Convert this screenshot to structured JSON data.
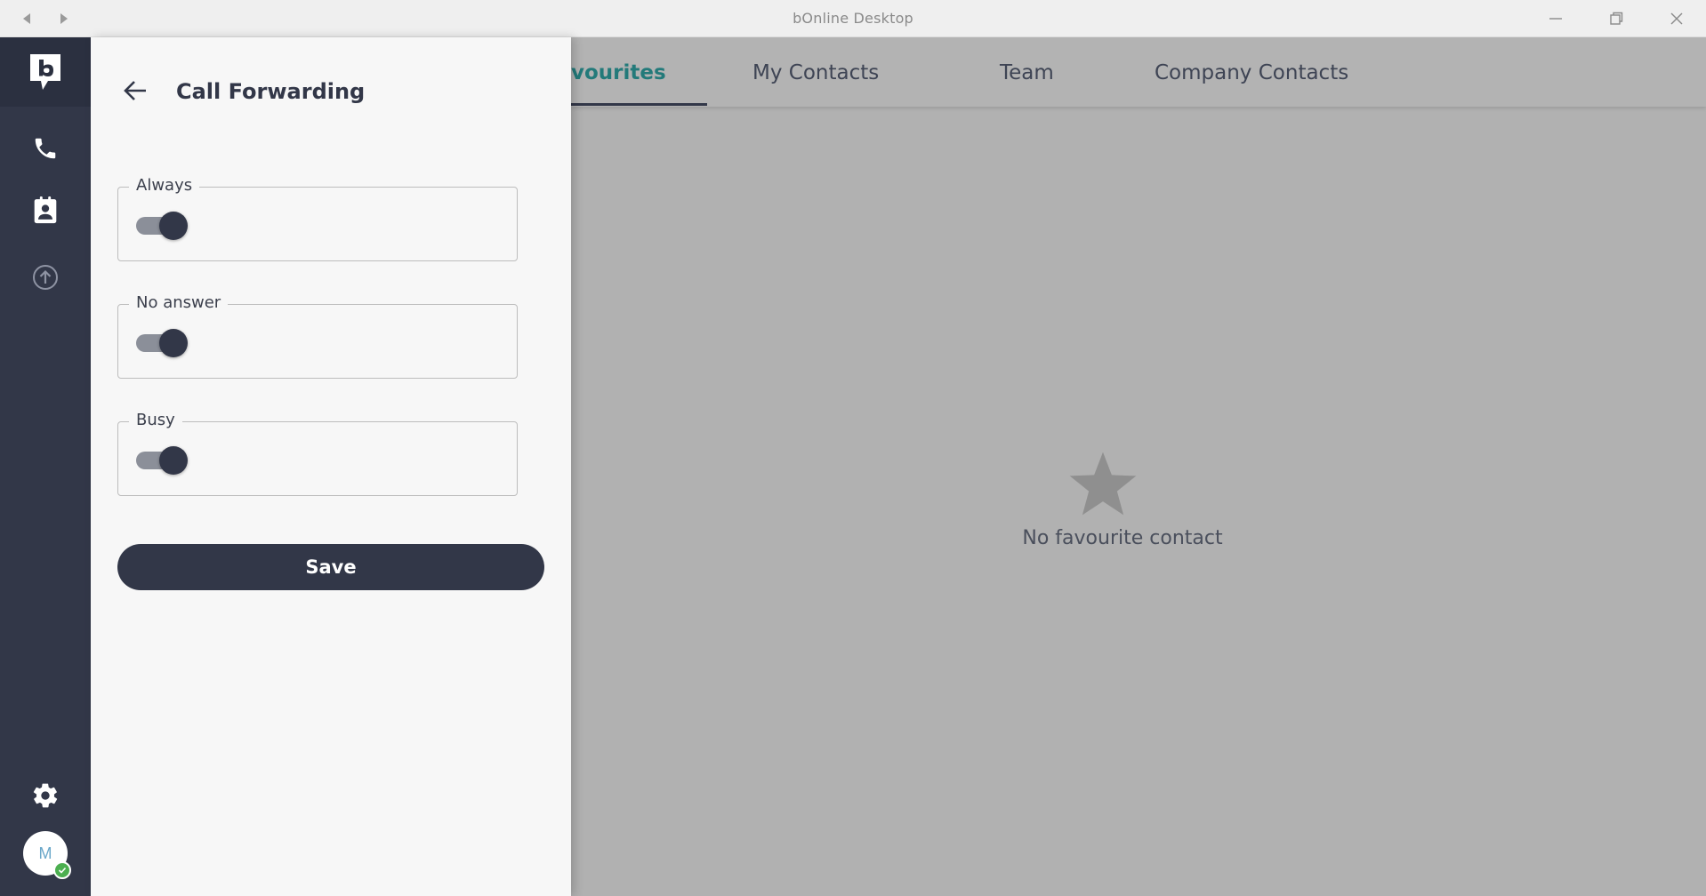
{
  "window": {
    "title": "bOnline Desktop"
  },
  "rail": {
    "logo_icon": "bonline-logo-icon",
    "items": [
      {
        "icon": "phone-icon"
      },
      {
        "icon": "contacts-icon"
      },
      {
        "icon": "upload-circle-icon"
      }
    ],
    "settings_icon": "gear-icon",
    "avatar": {
      "initial": "M",
      "status_color": "#4caf50"
    }
  },
  "tabs": [
    {
      "label": "vourites",
      "active": true
    },
    {
      "label": "My Contacts",
      "active": false
    },
    {
      "label": "Team",
      "active": false
    },
    {
      "label": "Company Contacts",
      "active": false
    }
  ],
  "empty_state": {
    "icon": "star-icon",
    "text": "No favourite contact"
  },
  "drawer": {
    "title": "Call Forwarding",
    "fields": [
      {
        "label": "Always",
        "enabled": true
      },
      {
        "label": "No answer",
        "enabled": true
      },
      {
        "label": "Busy",
        "enabled": true
      }
    ],
    "save_label": "Save"
  },
  "colors": {
    "rail": "#323748",
    "accent": "#237a7a",
    "drawer_bg": "#f7f7f7",
    "overlay": "#b1b1b1"
  }
}
